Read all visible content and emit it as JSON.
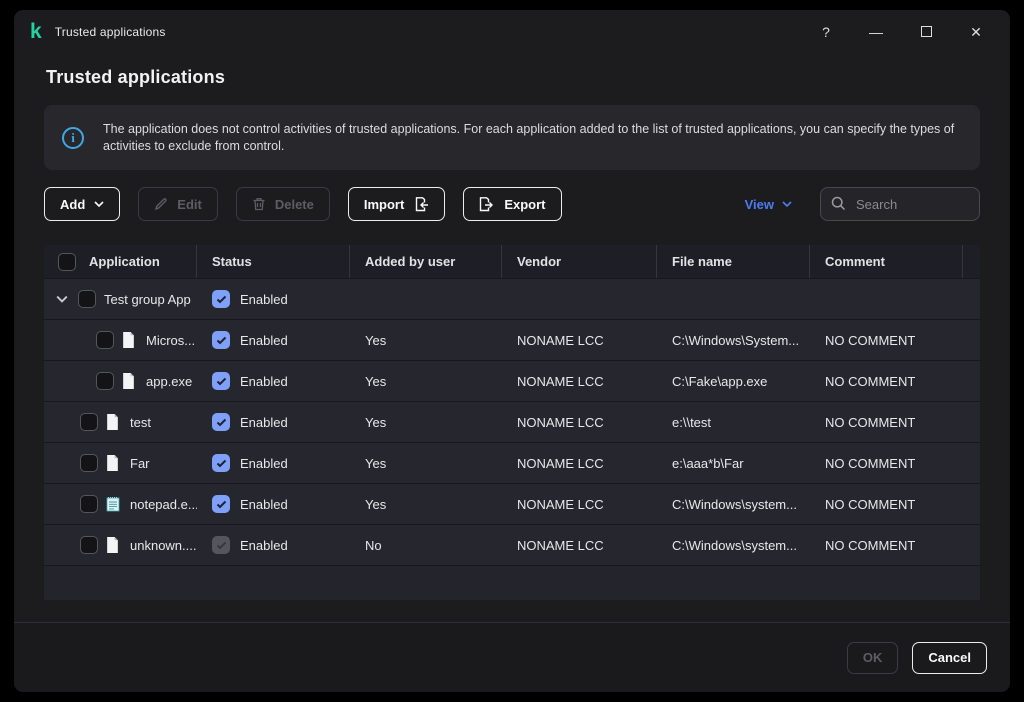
{
  "window": {
    "title": "Trusted applications",
    "controls": {
      "help": "?",
      "minimize": "—",
      "close": "✕"
    }
  },
  "page": {
    "title": "Trusted applications"
  },
  "banner": {
    "text": "The application does not control activities of trusted applications. For each application added to the list of trusted applications, you can specify the types of activities to exclude from control."
  },
  "toolbar": {
    "add_label": "Add",
    "edit_label": "Edit",
    "delete_label": "Delete",
    "import_label": "Import",
    "export_label": "Export",
    "view_label": "View",
    "search_placeholder": "Search"
  },
  "table": {
    "columns": [
      "Application",
      "Status",
      "Added by user",
      "Vendor",
      "File name",
      "Comment"
    ],
    "rows": [
      {
        "name": "Test group App",
        "status": "Enabled",
        "added": "",
        "vendor": "",
        "file": "",
        "comment": ""
      },
      {
        "name": "Micros...",
        "status": "Enabled",
        "added": "Yes",
        "vendor": "NONAME LCC",
        "file": "C:\\Windows\\System...",
        "comment": "NO COMMENT"
      },
      {
        "name": "app.exe",
        "status": "Enabled",
        "added": "Yes",
        "vendor": "NONAME LCC",
        "file": "C:\\Fake\\app.exe",
        "comment": "NO COMMENT"
      },
      {
        "name": "test",
        "status": "Enabled",
        "added": "Yes",
        "vendor": "NONAME LCC",
        "file": "e:\\\\test",
        "comment": "NO COMMENT"
      },
      {
        "name": "Far",
        "status": "Enabled",
        "added": "Yes",
        "vendor": "NONAME LCC",
        "file": "e:\\aaa*b\\Far",
        "comment": "NO COMMENT"
      },
      {
        "name": "notepad.e...",
        "status": "Enabled",
        "added": "Yes",
        "vendor": "NONAME LCC",
        "file": "C:\\Windows\\system...",
        "comment": "NO COMMENT"
      },
      {
        "name": "unknown....",
        "status": "Enabled",
        "added": "No",
        "vendor": "NONAME LCC",
        "file": "C:\\Windows\\system...",
        "comment": "NO COMMENT"
      }
    ]
  },
  "footer": {
    "ok_label": "OK",
    "cancel_label": "Cancel"
  },
  "colors": {
    "accent_blue": "#4d7cf0",
    "checkbox_checked": "#7ea0f8",
    "logo_teal": "#23d2a2",
    "info_icon_blue": "#41a7e4",
    "row_background": "#26262f",
    "window_background": "#1c1c1e"
  }
}
